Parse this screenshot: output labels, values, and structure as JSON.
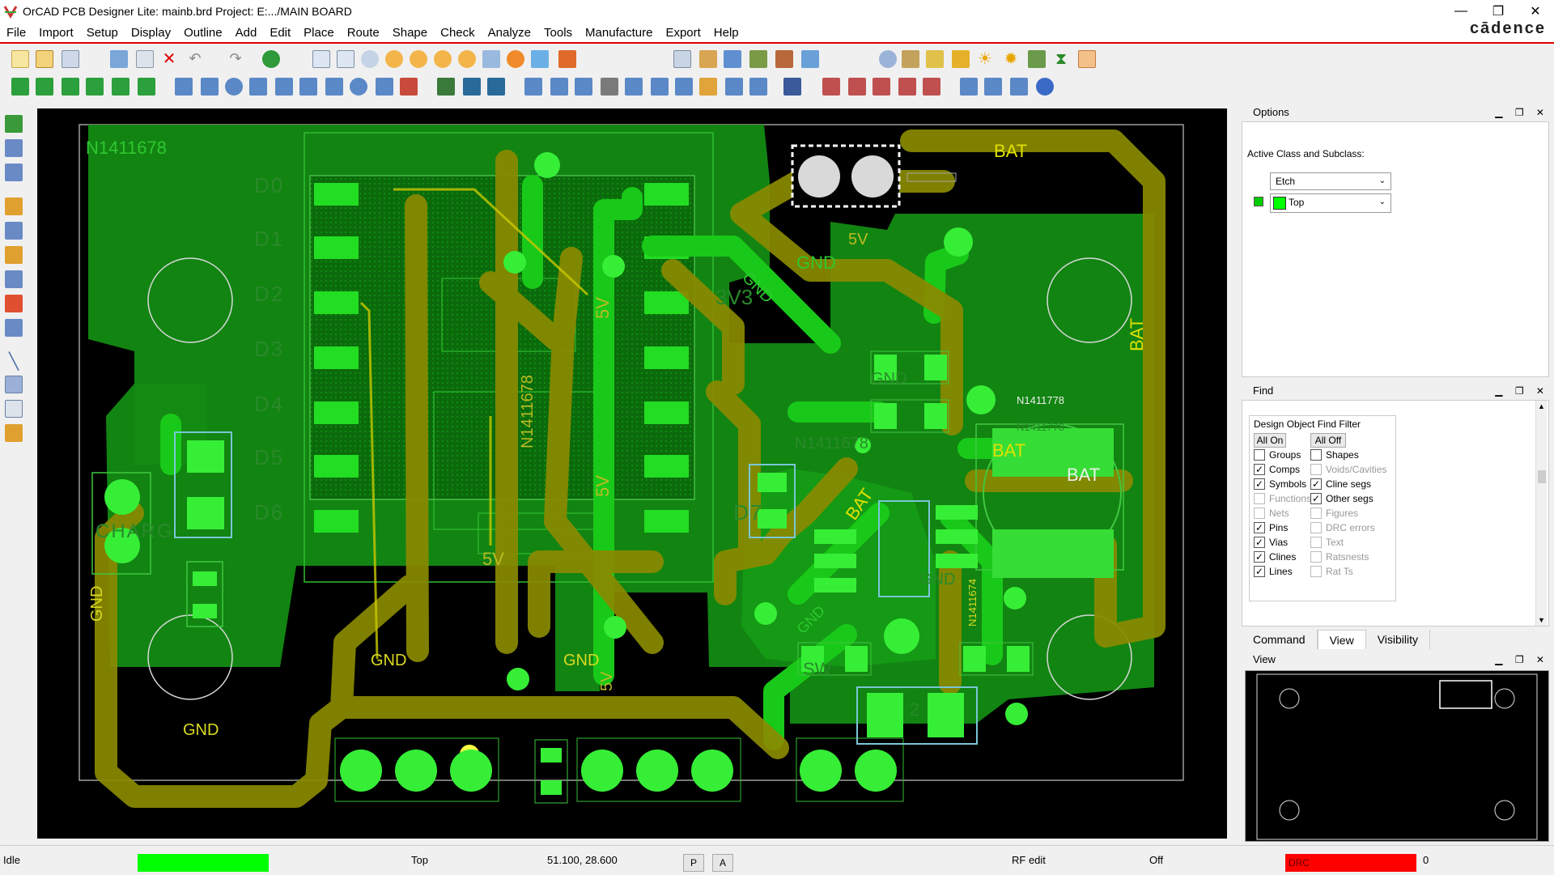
{
  "window": {
    "title": "OrCAD PCB Designer Lite: mainb.brd  Project: E:.../MAIN BOARD",
    "minimize": "—",
    "restore": "❐",
    "close": "✕"
  },
  "brand": "cādence",
  "menu": [
    "File",
    "Import",
    "Setup",
    "Display",
    "Outline",
    "Add",
    "Edit",
    "Place",
    "Route",
    "Shape",
    "Check",
    "Analyze",
    "Tools",
    "Manufacture",
    "Export",
    "Help"
  ],
  "pcb": {
    "labels": {
      "n_top": "N1411678",
      "d0": "D0",
      "d1": "D1",
      "d2": "D2",
      "d3": "D3",
      "d4": "D4",
      "d5": "D5",
      "d6": "D6",
      "d7": "D7",
      "bat_top": "BAT",
      "bat_right": "BAT",
      "bat_mid": "BAT",
      "bat_big": "BAT",
      "bat_diag": "BAT",
      "fivev_top": "5V",
      "fivev_a": "5V",
      "fivev_b": "5V",
      "fivev_low": "5V",
      "fivev_c": "5V",
      "gnd_a": "GND",
      "gnd_b": "GND",
      "gnd_c": "GND",
      "gnd_left": "GND",
      "gnd_bottom": "GND",
      "gnd_mid": "GND",
      "gnd_diag": "GND",
      "gnd_diag2": "GND",
      "gnd_right": "GND",
      "threev3": "3V3",
      "n_vertical": "N1411678",
      "n_chip": "N1411778",
      "n_chip2": "N1411778",
      "n_mid": "N1411678",
      "charg": "CHARG",
      "sw": "SW",
      "two": "2",
      "n_right": "N1411674"
    }
  },
  "options_panel": {
    "title": "Options",
    "active_label": "Active Class and Subclass:",
    "class_value": "Etch",
    "subclass_value": "Top",
    "swatch_color": "#00ff00"
  },
  "find_panel": {
    "title": "Find",
    "filter_title": "Design Object Find Filter",
    "all_on": "All On",
    "all_off": "All Off",
    "items_left": [
      {
        "label": "Groups",
        "checked": false,
        "enabled": true
      },
      {
        "label": "Comps",
        "checked": true,
        "enabled": true
      },
      {
        "label": "Symbols",
        "checked": true,
        "enabled": true
      },
      {
        "label": "Functions",
        "checked": false,
        "enabled": false
      },
      {
        "label": "Nets",
        "checked": false,
        "enabled": false
      },
      {
        "label": "Pins",
        "checked": true,
        "enabled": true
      },
      {
        "label": "Vias",
        "checked": true,
        "enabled": true
      },
      {
        "label": "Clines",
        "checked": true,
        "enabled": true
      },
      {
        "label": "Lines",
        "checked": true,
        "enabled": true
      }
    ],
    "items_right": [
      {
        "label": "Shapes",
        "checked": false,
        "enabled": true
      },
      {
        "label": "Voids/Cavities",
        "checked": false,
        "enabled": false
      },
      {
        "label": "Cline segs",
        "checked": true,
        "enabled": true
      },
      {
        "label": "Other segs",
        "checked": true,
        "enabled": true
      },
      {
        "label": "Figures",
        "checked": false,
        "enabled": false
      },
      {
        "label": "DRC errors",
        "checked": false,
        "enabled": false
      },
      {
        "label": "Text",
        "checked": false,
        "enabled": false
      },
      {
        "label": "Ratsnests",
        "checked": false,
        "enabled": false
      },
      {
        "label": "Rat Ts",
        "checked": false,
        "enabled": false
      }
    ]
  },
  "tabs": [
    "Command",
    "View",
    "Visibility"
  ],
  "active_tab": "View",
  "view_panel": {
    "title": "View"
  },
  "status": {
    "state": "Idle",
    "layer": "Top",
    "coords": "51.100, 28.600",
    "p_btn": "P",
    "a_btn": "A",
    "mode": "RF edit",
    "off": "Off",
    "drc": "DRC",
    "drc_count": "0",
    "idle_color": "#00ff00",
    "drc_color": "#ff0000"
  }
}
